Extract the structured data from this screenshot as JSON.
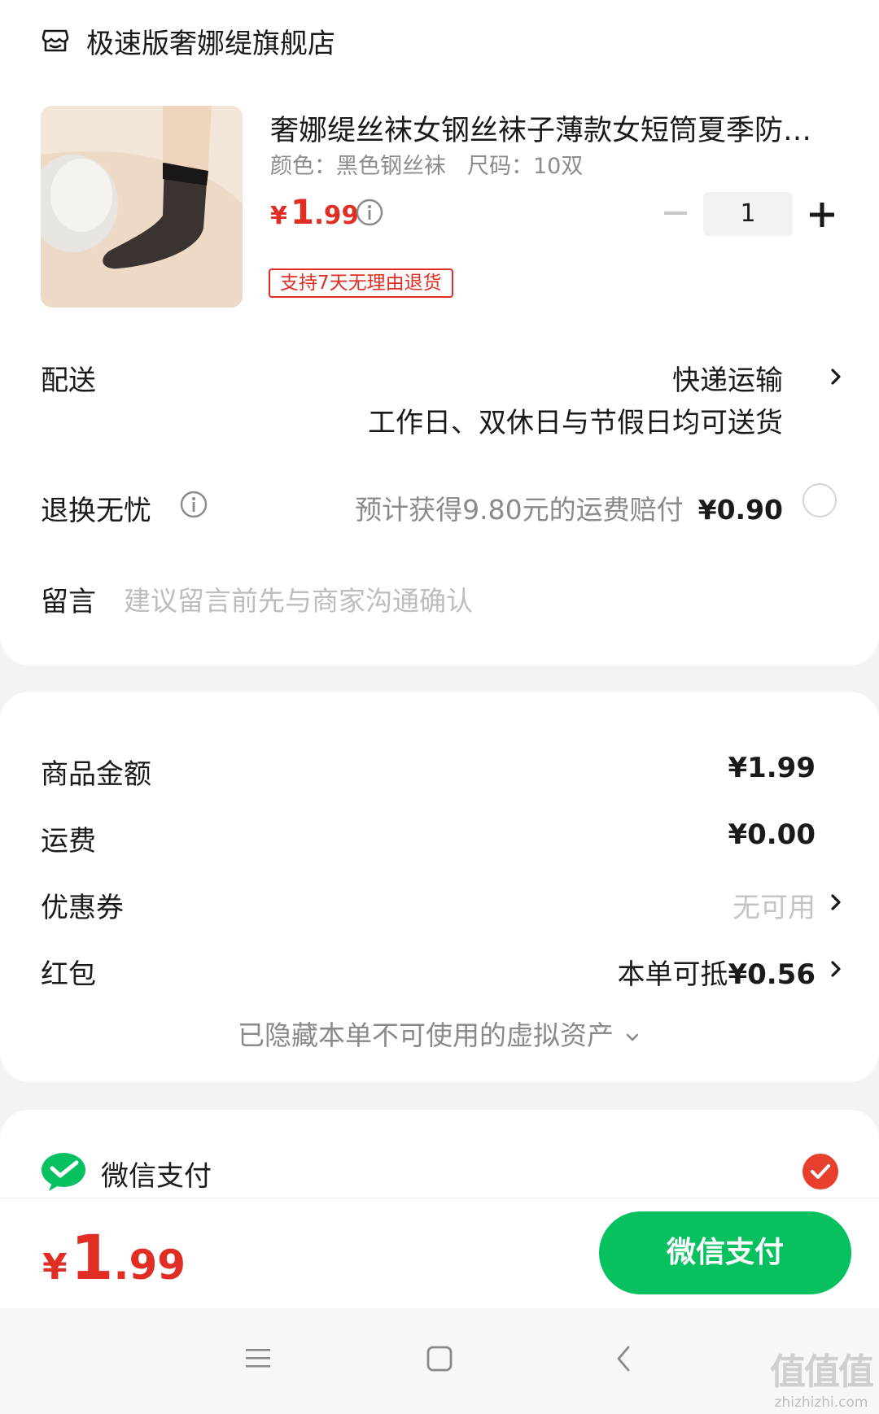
{
  "store": {
    "name": "极速版奢娜缇旗舰店",
    "icon": "store-icon"
  },
  "product": {
    "title": "奢娜缇丝袜女钢丝袜子薄款女短筒夏季防…",
    "color_spec": "颜色：黑色钢丝袜",
    "size_spec": "尺码：10双",
    "price_symbol": "¥",
    "price_int": "1",
    "price_dec": ".99",
    "quantity": "1",
    "return_tag": "支持7天无理由退货"
  },
  "delivery": {
    "label": "配送",
    "method": "快递运输",
    "note": "工作日、双休日与节假日均可送货"
  },
  "return_insurance": {
    "label": "退换无忧",
    "desc": "预计获得9.80元的运费赔付",
    "price": "¥0.90"
  },
  "message": {
    "label": "留言",
    "placeholder": "建议留言前先与商家沟通确认"
  },
  "amounts": {
    "goods_label": "商品金额",
    "goods_value": "¥1.99",
    "shipping_label": "运费",
    "shipping_value": "¥0.00",
    "coupon_label": "优惠券",
    "coupon_value": "无可用",
    "redpacket_label": "红包",
    "redpacket_prefix": "本单可抵",
    "redpacket_value": "¥0.56",
    "hidden_assets": "已隐藏本单不可使用的虚拟资产"
  },
  "payment": {
    "method_label": "微信支付",
    "method_icon": "wechat-pay-icon"
  },
  "paybar": {
    "total_symbol": "¥",
    "total_int": "1",
    "total_dec": ".99",
    "pay_button": "微信支付"
  },
  "watermark": {
    "big": "值值值",
    "small": "zhizhizhi.com"
  },
  "colors": {
    "accent_red": "#e02e24",
    "wechat_green": "#07c160"
  }
}
